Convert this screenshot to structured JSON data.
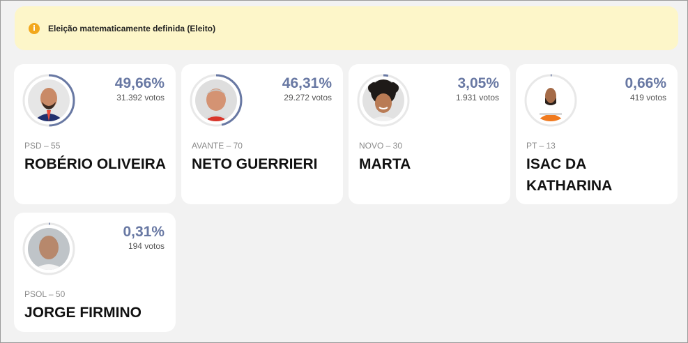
{
  "banner": {
    "icon": "info-icon",
    "icon_color": "#f2a81d",
    "text": "Eleição matematicamente definida (Eleito)"
  },
  "accent_color": "#6878a3",
  "candidates": [
    {
      "percent": "49,66%",
      "votes": "31.392 votos",
      "party": "PSD – 55",
      "name": "ROBÉRIO OLIVEIRA",
      "share": 0.4966
    },
    {
      "percent": "46,31%",
      "votes": "29.272 votos",
      "party": "AVANTE – 70",
      "name": "NETO GUERRIERI",
      "share": 0.4631
    },
    {
      "percent": "3,05%",
      "votes": "1.931 votos",
      "party": "NOVO – 30",
      "name": "MARTA",
      "share": 0.0305
    },
    {
      "percent": "0,66%",
      "votes": "419 votos",
      "party": "PT – 13",
      "name": "ISAC DA KATHARINA",
      "share": 0.0066
    },
    {
      "percent": "0,31%",
      "votes": "194 votos",
      "party": "PSOL – 50",
      "name": "JORGE FIRMINO",
      "share": 0.0031
    }
  ]
}
